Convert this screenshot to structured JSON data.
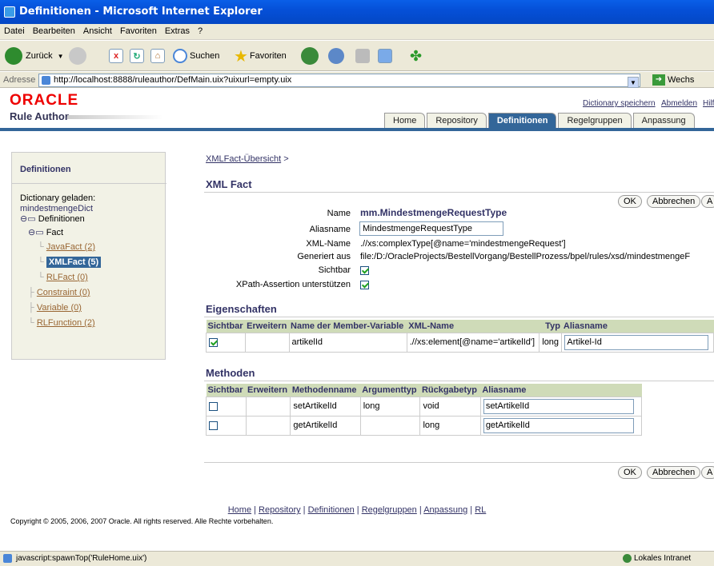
{
  "window": {
    "title": "Definitionen - Microsoft Internet Explorer"
  },
  "menu": [
    "Datei",
    "Bearbeiten",
    "Ansicht",
    "Favoriten",
    "Extras",
    "?"
  ],
  "toolbar": {
    "back": "Zurück",
    "search": "Suchen",
    "favorites": "Favoriten"
  },
  "address": {
    "label": "Adresse",
    "url": "http://localhost:8888/ruleauthor/DefMain.uix?uixurl=empty.uix",
    "go": "Wechs"
  },
  "header": {
    "logo": "ORACLE",
    "app": "Rule Author",
    "links": [
      "Dictionary speichern",
      "Abmelden",
      "Hilf"
    ]
  },
  "tabs": [
    "Home",
    "Repository",
    "Definitionen",
    "Regelgruppen",
    "Anpassung"
  ],
  "side": {
    "title": "Definitionen",
    "loaded": "Dictionary geladen:",
    "dict": "mindestmengeDict",
    "defs": "Definitionen",
    "fact": "Fact",
    "java": "JavaFact (2)",
    "xml": "XMLFact (5)",
    "rl": "RLFact (0)",
    "constraint": "Constraint (0)",
    "variable": "Variable (0)",
    "rlfunc": "RLFunction (2)"
  },
  "breadcrumb": {
    "link": "XMLFact-Übersicht",
    "sep": ">"
  },
  "main": {
    "title": "XML Fact",
    "ok": "OK",
    "cancel": "Abbrechen",
    "more": "A"
  },
  "form": {
    "name_l": "Name",
    "name_v": "mm.MindestmengeRequestType",
    "alias_l": "Aliasname",
    "alias_v": "MindestmengeRequestType",
    "xml_l": "XML-Name",
    "xml_v": ".//xs:complexType[@name='mindestmengeRequest']",
    "gen_l": "Generiert aus",
    "gen_v": "file:/D:/OracleProjects/BestellVorgang/BestellProzess/bpel/rules/xsd/mindestmengeF",
    "vis_l": "Sichtbar",
    "xp_l": "XPath-Assertion unterstützen"
  },
  "props": {
    "title": "Eigenschaften",
    "cols": [
      "Sichtbar",
      "Erweitern",
      "Name der Member-Variable",
      "XML-Name",
      "Typ",
      "Aliasname"
    ],
    "rows": [
      {
        "name": "artikelId",
        "xml": ".//xs:element[@name='artikelId']",
        "type": "long",
        "alias": "Artikel-Id"
      }
    ]
  },
  "methods": {
    "title": "Methoden",
    "cols": [
      "Sichtbar",
      "Erweitern",
      "Methodenname",
      "Argumenttyp",
      "Rückgabetyp",
      "Aliasname"
    ],
    "rows": [
      {
        "name": "setArtikelId",
        "arg": "long",
        "ret": "void",
        "alias": "setArtikelId"
      },
      {
        "name": "getArtikelId",
        "arg": "",
        "ret": "long",
        "alias": "getArtikelId"
      }
    ]
  },
  "footer": {
    "links": [
      "Home",
      "Repository",
      "Definitionen",
      "Regelgruppen",
      "Anpassung",
      "RL"
    ],
    "copy": "Copyright © 2005, 2006, 2007 Oracle. All rights reserved. Alle Rechte vorbehalten."
  },
  "status": {
    "left": "javascript:spawnTop('RuleHome.uix')",
    "right": "Lokales Intranet"
  }
}
